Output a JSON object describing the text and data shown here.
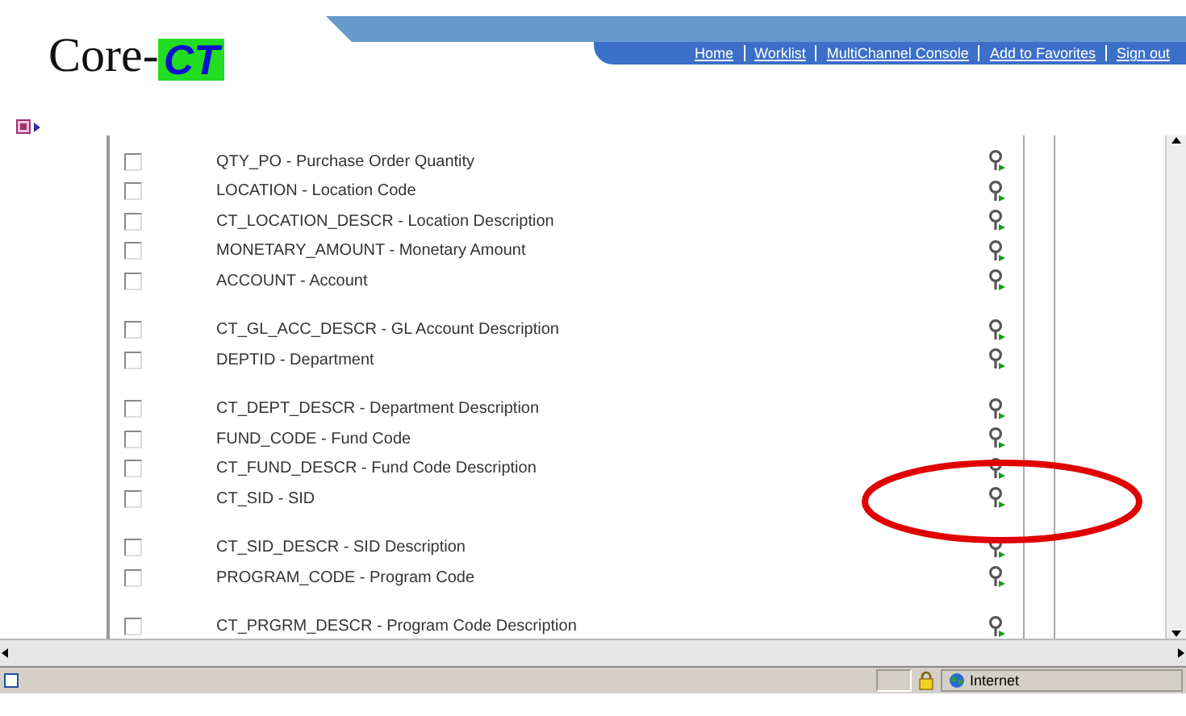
{
  "logo": {
    "prefix": "Core-",
    "highlight": "CT"
  },
  "nav_links": [
    "Home",
    "Worklist",
    "MultiChannel Console",
    "Add to Favorites",
    "Sign out"
  ],
  "field_groups": [
    [
      {
        "label": "QTY_PO - Purchase Order Quantity",
        "checked": false
      },
      {
        "label": "LOCATION - Location Code",
        "checked": false
      },
      {
        "label": "CT_LOCATION_DESCR - Location Description",
        "checked": false
      },
      {
        "label": "MONETARY_AMOUNT - Monetary Amount",
        "checked": false
      },
      {
        "label": "ACCOUNT - Account",
        "checked": false
      }
    ],
    [
      {
        "label": "CT_GL_ACC_DESCR - GL Account Description",
        "checked": false
      },
      {
        "label": "DEPTID - Department",
        "checked": false
      }
    ],
    [
      {
        "label": "CT_DEPT_DESCR - Department Description",
        "checked": false
      },
      {
        "label": "FUND_CODE - Fund Code",
        "checked": false
      },
      {
        "label": "CT_FUND_DESCR - Fund Code Description",
        "checked": false
      },
      {
        "label": "CT_SID - SID",
        "checked": false
      }
    ],
    [
      {
        "label": "CT_SID_DESCR - SID Description",
        "checked": false
      },
      {
        "label": "PROGRAM_CODE - Program Code",
        "checked": false
      }
    ],
    [
      {
        "label": "CT_PRGRM_DESCR - Program Code Description",
        "checked": false
      }
    ]
  ],
  "status_bar": {
    "zone": "Internet"
  }
}
